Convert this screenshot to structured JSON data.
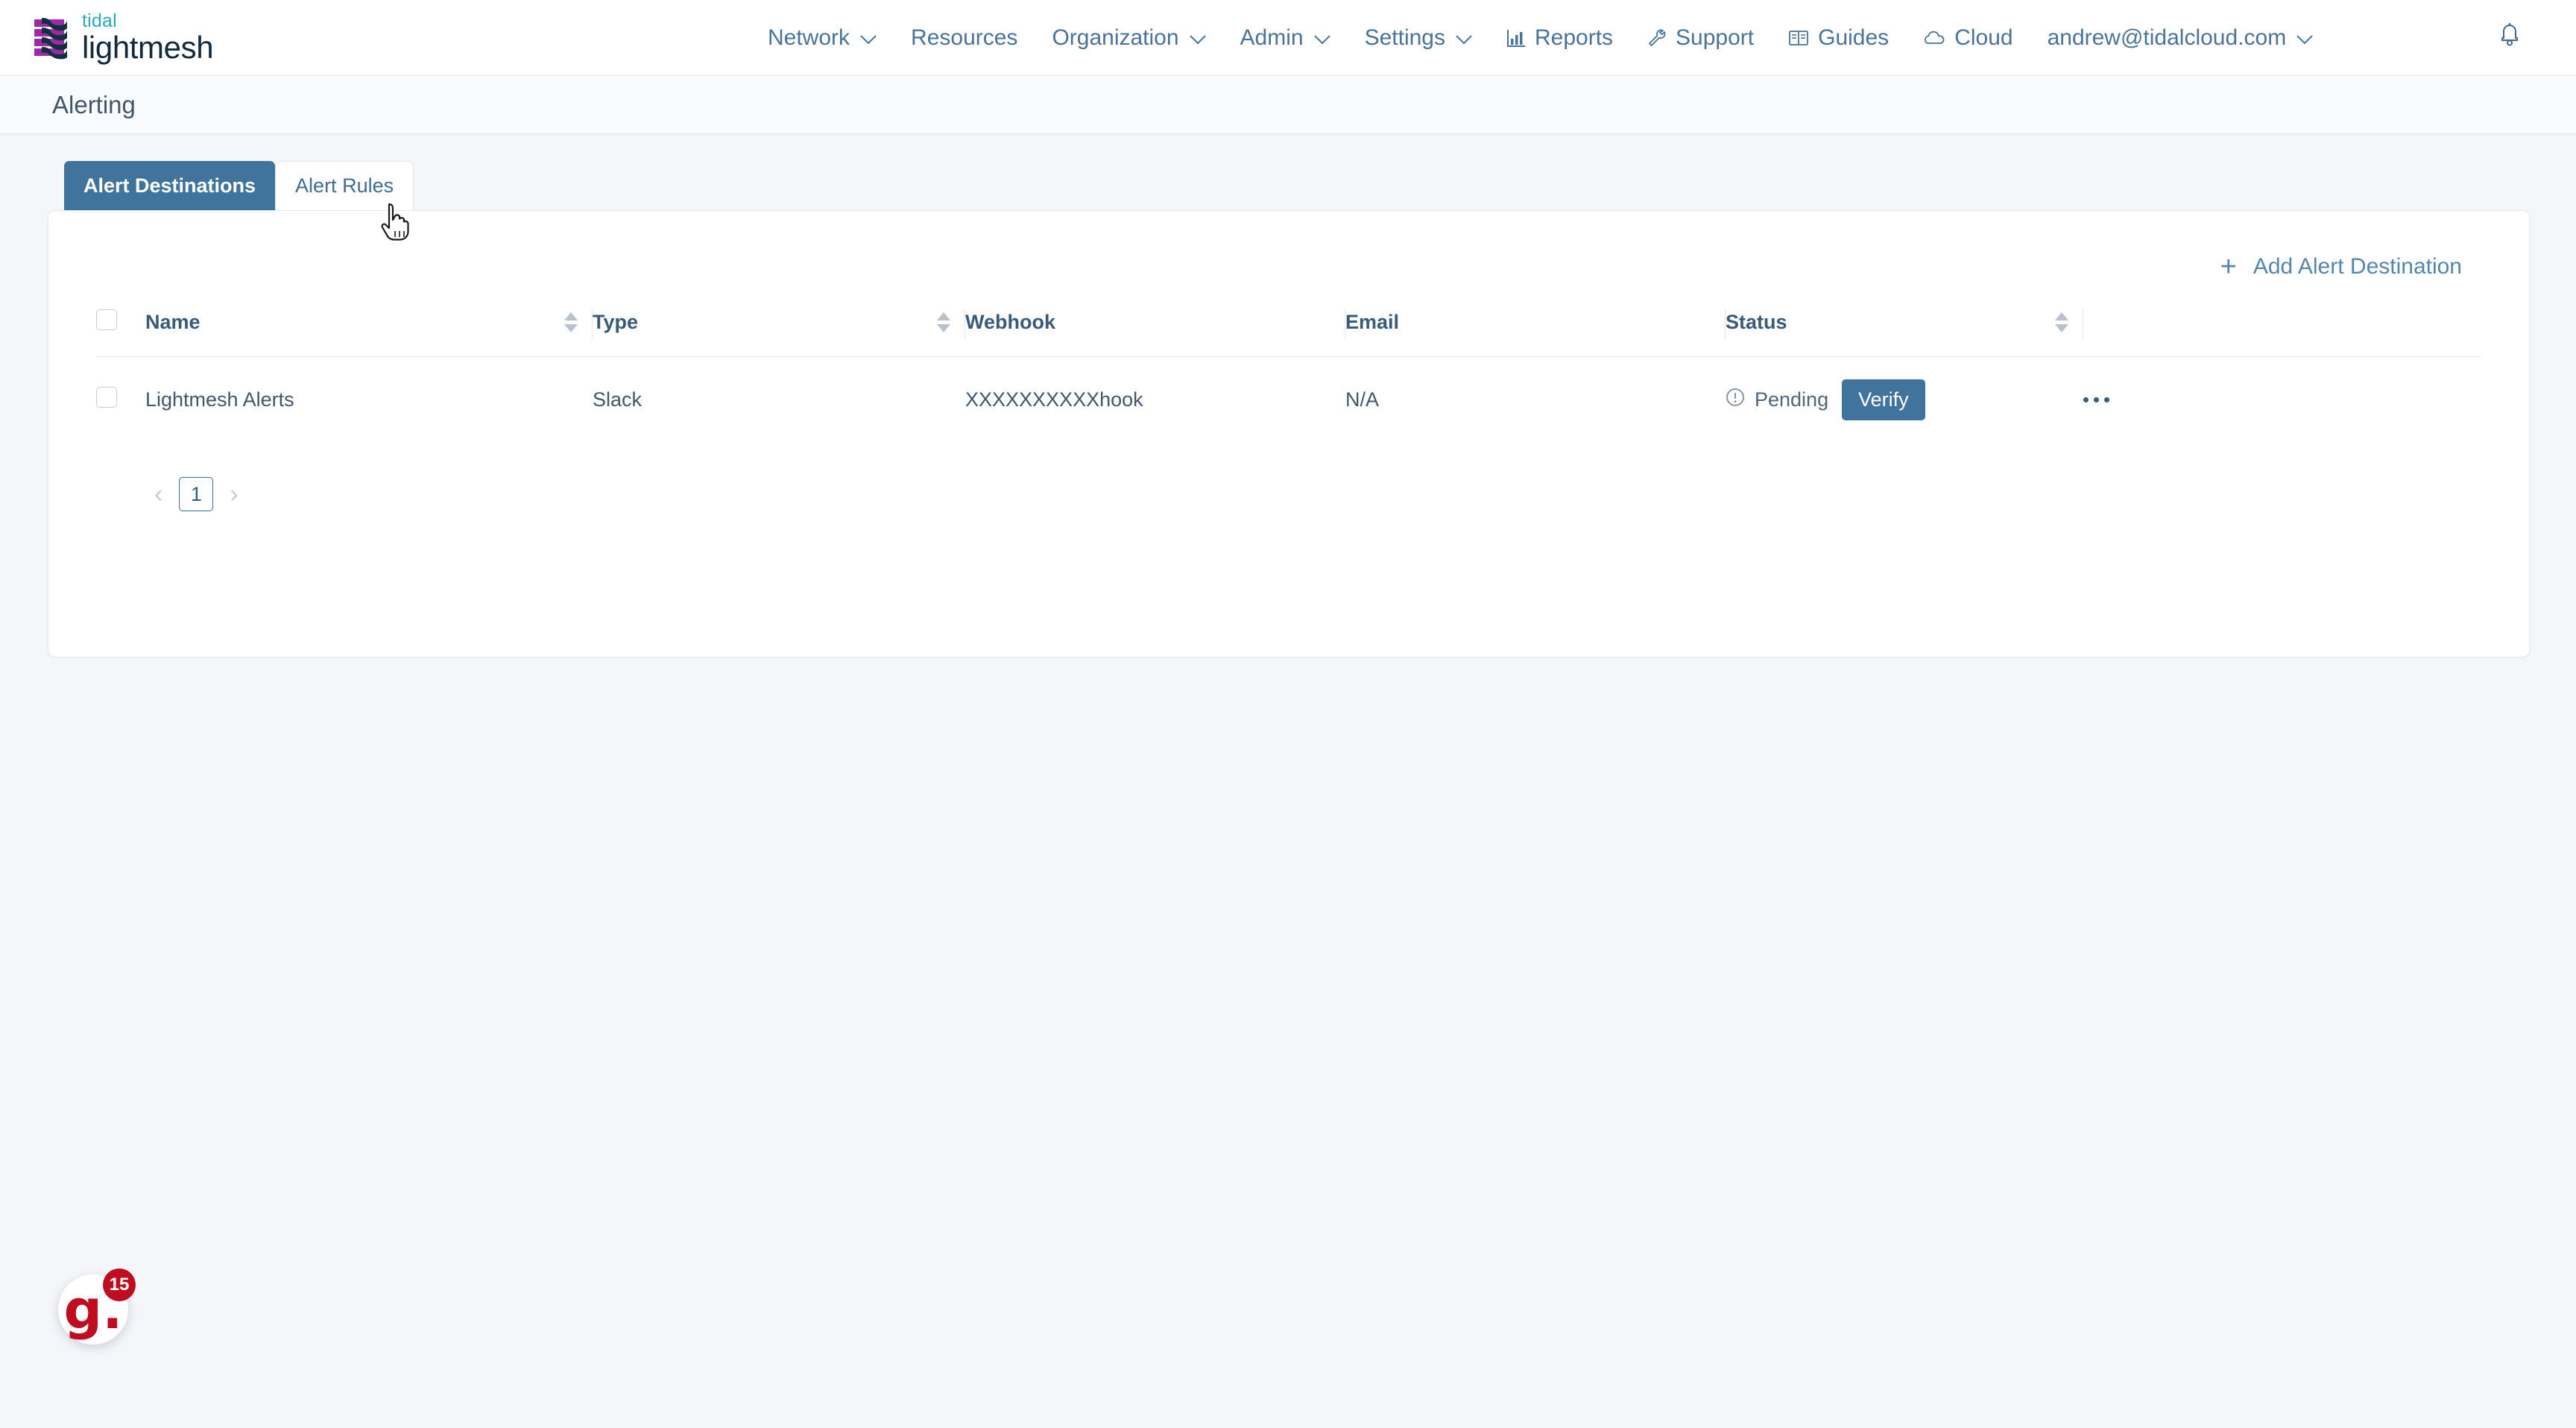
{
  "brand": {
    "logo_icon": "lightmesh-stack-logo",
    "name_top": "tidal",
    "name_bottom": "lightmesh",
    "teal": "#2ba5c0",
    "purple": "#9b29a8",
    "navy": "#13293d"
  },
  "topnav": {
    "items": [
      {
        "label": "Network",
        "icon": "chevron-down-icon",
        "has_chevron": true
      },
      {
        "label": "Resources",
        "icon": "",
        "has_chevron": false
      },
      {
        "label": "Organization",
        "icon": "chevron-down-icon",
        "has_chevron": true
      },
      {
        "label": "Admin",
        "icon": "chevron-down-icon",
        "has_chevron": true
      },
      {
        "label": "Settings",
        "icon": "chevron-down-icon",
        "has_chevron": true
      },
      {
        "label": "Reports",
        "icon": "bar-chart-icon",
        "has_chevron": false
      },
      {
        "label": "Support",
        "icon": "wrench-icon",
        "has_chevron": false
      },
      {
        "label": "Guides",
        "icon": "book-icon",
        "has_chevron": false
      },
      {
        "label": "Cloud",
        "icon": "cloud-icon",
        "has_chevron": false
      },
      {
        "label": "andrew@tidalcloud.com",
        "icon": "chevron-down-icon",
        "has_chevron": true
      }
    ],
    "notification_icon": "bell-icon",
    "link_color": "#4a7399"
  },
  "page": {
    "title": "Alerting"
  },
  "tabs": [
    {
      "label": "Alert Destinations",
      "active": true
    },
    {
      "label": "Alert Rules",
      "active": false
    }
  ],
  "toolbar": {
    "add_label": "Add Alert Destination",
    "add_icon": "plus-icon",
    "accent": "#5586ad"
  },
  "table": {
    "select_all_icon": "checkbox-icon",
    "columns": [
      {
        "label": "Name",
        "sortable": true
      },
      {
        "label": "Type",
        "sortable": true
      },
      {
        "label": "Webhook",
        "sortable": false
      },
      {
        "label": "Email",
        "sortable": false
      },
      {
        "label": "Status",
        "sortable": true
      }
    ],
    "rows": [
      {
        "name": "Lightmesh Alerts",
        "type": "Slack",
        "webhook": "XXXXXXXXXXhook",
        "email": "N/A",
        "status_label": "Pending",
        "status_icon": "alert-circle-icon",
        "action_label": "Verify",
        "menu_icon": "more-horizontal-icon"
      }
    ]
  },
  "pagination": {
    "prev_icon": "chevron-left-icon",
    "next_icon": "chevron-right-icon",
    "pages": [
      "1"
    ],
    "current": "1"
  },
  "help_widget": {
    "logo_text": "g.",
    "badge_count": "15",
    "color": "#bf0d1f"
  },
  "cursor": {
    "icon": "pointer-hand-cursor",
    "over": "Alert Rules"
  }
}
